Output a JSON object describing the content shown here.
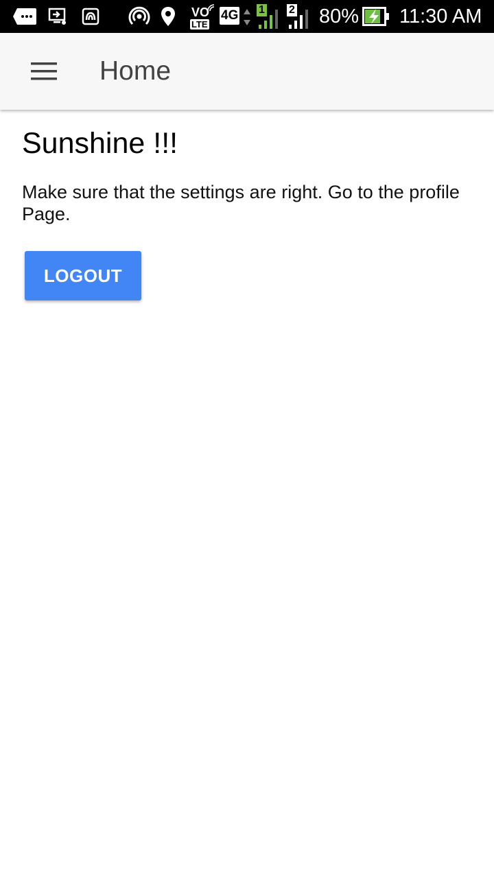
{
  "status_bar": {
    "battery_percent": "80%",
    "time": "11:30 AM",
    "volte_label_top": "VO",
    "volte_label_bottom": "LTE",
    "network_type": "4G",
    "sim1_label": "1",
    "sim2_label": "2",
    "icons": [
      "messages-icon",
      "screen-cast-icon",
      "nfc-icon",
      "hotspot-icon",
      "location-icon",
      "volte-icon",
      "network-4g-icon",
      "signal-sim1-icon",
      "signal-sim2-icon",
      "battery-charging-icon"
    ],
    "colors": {
      "sim1_signal": "#7cc242",
      "battery_fill": "#6ec043"
    }
  },
  "app_bar": {
    "title": "Home",
    "menu_icon": "hamburger-menu-icon",
    "background": "#f7f7f7"
  },
  "main": {
    "heading": "Sunshine !!!",
    "message": "Make sure that the settings are right. Go to the profile Page.",
    "logout_label": "LOGOUT",
    "logout_color": "#4285f4"
  }
}
